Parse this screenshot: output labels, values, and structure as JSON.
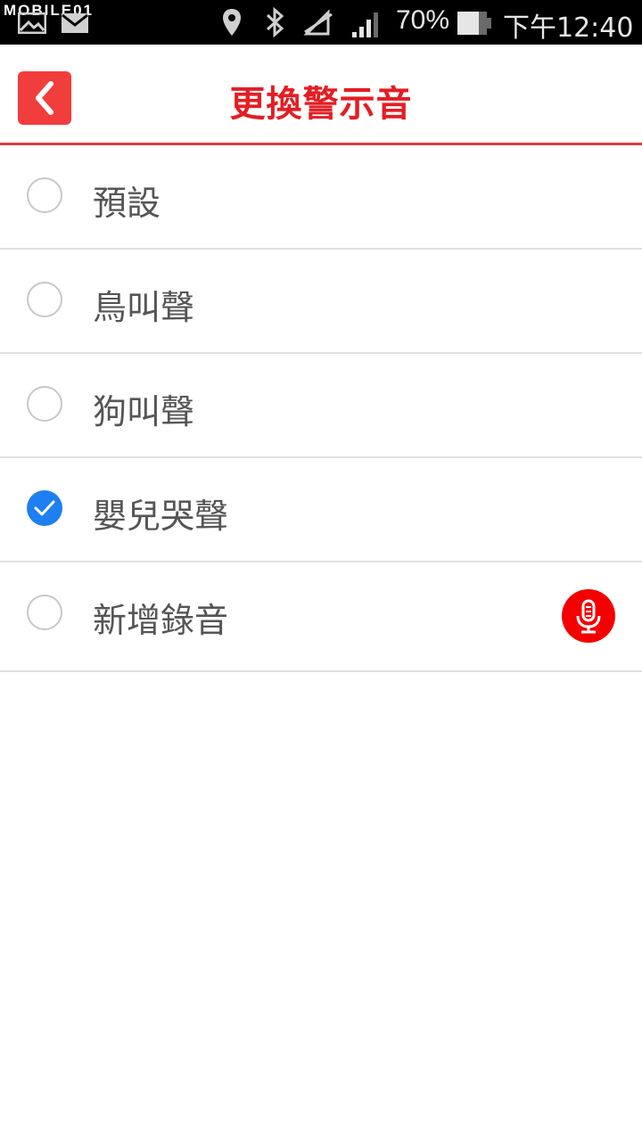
{
  "status_bar": {
    "watermark": "MOBILE01",
    "battery_percent": "70%",
    "time": "下午12:40",
    "icons": [
      "image-icon",
      "gmail-icon",
      "location-icon",
      "bluetooth-icon",
      "no-data-icon",
      "signal-icon",
      "battery-icon"
    ]
  },
  "header": {
    "title": "更換警示音",
    "back_icon": "chevron-left-icon",
    "accent_color": "#e31e24"
  },
  "sounds": {
    "items": [
      {
        "label": "預設",
        "checked": false
      },
      {
        "label": "鳥叫聲",
        "checked": false
      },
      {
        "label": "狗叫聲",
        "checked": false
      },
      {
        "label": "嬰兒哭聲",
        "checked": true
      },
      {
        "label": "新增錄音",
        "checked": false,
        "action_icon": "microphone-icon"
      }
    ],
    "check_color": "#1e7ff0",
    "record_color": "#f50000"
  }
}
